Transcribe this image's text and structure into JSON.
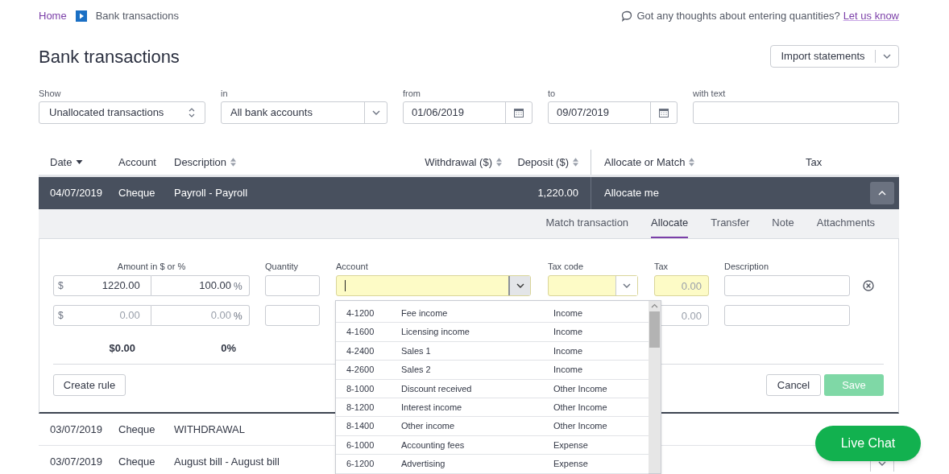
{
  "breadcrumb": [
    {
      "label": "Home",
      "kind": "link"
    },
    {
      "label": "Bank transactions",
      "kind": "current"
    }
  ],
  "feedback": {
    "text": "Got any thoughts about entering quantities?",
    "link": "Let us know"
  },
  "title": "Bank transactions",
  "import_button": "Import statements",
  "filters": [
    {
      "label": "Show",
      "value": "Unallocated transactions",
      "kind": "select"
    },
    {
      "label": "in",
      "value": "All bank accounts",
      "kind": "dropdown"
    },
    {
      "label": "from",
      "value": "01/06/2019",
      "kind": "date"
    },
    {
      "label": "to",
      "value": "09/07/2019",
      "kind": "date"
    },
    {
      "label": "with text",
      "kind": "text"
    }
  ],
  "table": {
    "columns": [
      {
        "label": "Date",
        "sorted_desc": true
      },
      {
        "label": "Account",
        "sortable": false
      },
      {
        "label": "Description",
        "sortable": true
      },
      {
        "label": "Withdrawal ($)",
        "sortable": true
      },
      {
        "label": "Deposit ($)",
        "sortable": true
      },
      {
        "label": "Allocate or Match",
        "sortable": true
      },
      {
        "label": "Tax",
        "sortable": false
      }
    ],
    "rows": [
      {
        "date": "04/07/2019",
        "account": "Cheque",
        "description": "Payroll - Payroll",
        "deposit": "1,220.00",
        "allocate": "Allocate me",
        "expanded": true
      },
      {
        "date": "03/07/2019",
        "account": "Cheque",
        "description": "WITHDRAWAL",
        "expanded": false
      },
      {
        "date": "03/07/2019",
        "account": "Cheque",
        "description": "August bill - August bill",
        "expanded": false
      }
    ]
  },
  "detail": {
    "tabs": [
      {
        "label": "Match transaction",
        "selected": false
      },
      {
        "label": "Allocate",
        "selected": true
      },
      {
        "label": "Transfer",
        "selected": false
      },
      {
        "label": "Note",
        "selected": false
      },
      {
        "label": "Attachments",
        "selected": false
      }
    ],
    "labels": {
      "amount": "Amount in $ or %",
      "quantity": "Quantity",
      "account": "Account",
      "tax_code": "Tax code",
      "tax": "Tax",
      "description": "Description"
    },
    "lines": [
      {
        "currency": "$",
        "amount": "1220.00",
        "percent": "100.00",
        "percent_sign": "%",
        "highlighted": true,
        "account": {
          "focused": true
        },
        "tax_code": {
          "focused": false
        },
        "tax": {
          "placeholder": "0.00"
        },
        "removable": true
      },
      {
        "currency": "$",
        "amount_placeholder": "0.00",
        "percent_placeholder": "0.00",
        "percent_sign": "%",
        "highlighted": false,
        "tax": {
          "placeholder": "0.00"
        },
        "removable": false
      }
    ],
    "total_amount": "$0.00",
    "total_percent": "0%",
    "create_rule": "Create rule",
    "cancel": "Cancel",
    "save": {
      "label": "Save",
      "disabled": true
    }
  },
  "account_dropdown": [
    {
      "code": "4-1200",
      "name": "Fee income",
      "type": "Income"
    },
    {
      "code": "4-1600",
      "name": "Licensing income",
      "type": "Income"
    },
    {
      "code": "4-2400",
      "name": "Sales 1",
      "type": "Income"
    },
    {
      "code": "4-2600",
      "name": "Sales 2",
      "type": "Income"
    },
    {
      "code": "8-1000",
      "name": "Discount received",
      "type": "Other Income"
    },
    {
      "code": "8-1200",
      "name": "Interest income",
      "type": "Other Income"
    },
    {
      "code": "8-1400",
      "name": "Other income",
      "type": "Other Income"
    },
    {
      "code": "6-1000",
      "name": "Accounting fees",
      "type": "Expense"
    },
    {
      "code": "6-1200",
      "name": "Advertising",
      "type": "Expense"
    }
  ],
  "live_chat": "Live Chat"
}
